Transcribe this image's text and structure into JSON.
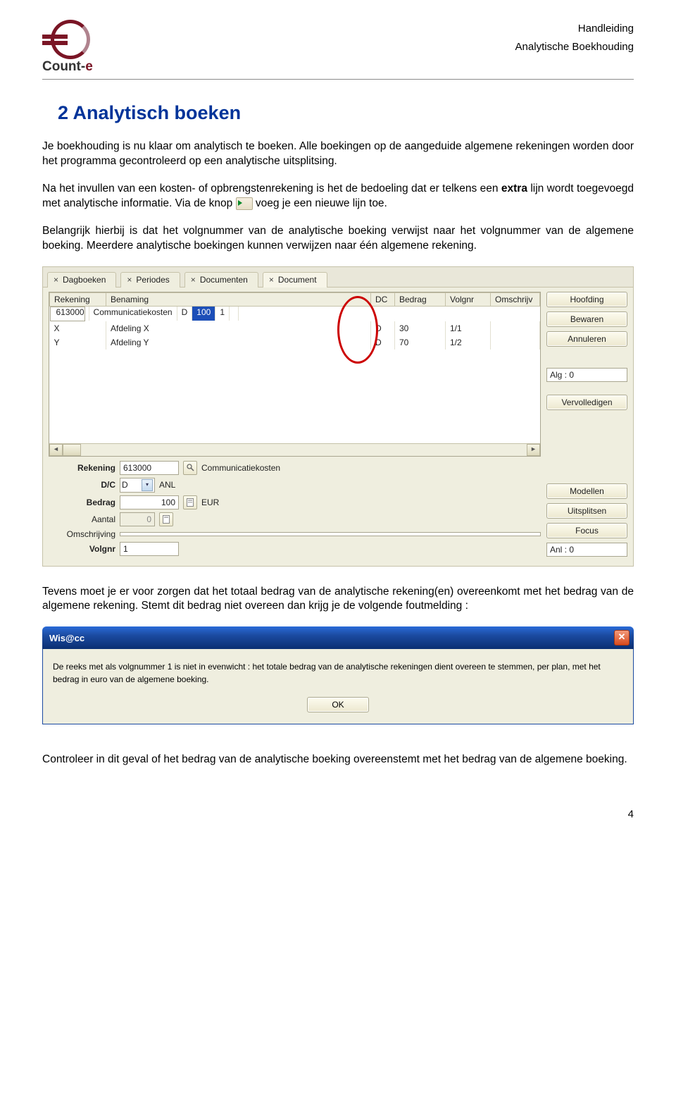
{
  "header": {
    "logo_text_1": "Count-",
    "logo_text_2": "e",
    "right_line1": "Handleiding",
    "right_line2": "Analytische Boekhouding"
  },
  "title": "2 Analytisch boeken",
  "para1": "Je boekhouding is nu klaar om analytisch te boeken. Alle boekingen op de aangeduide algemene rekeningen worden door het programma gecontroleerd op een analytische uitsplitsing.",
  "para2_a": "Na het invullen van een kosten- of opbrengstenrekening is het de bedoeling dat er telkens een ",
  "para2_bold": "extra",
  "para2_b": " lijn wordt toegevoegd met analytische informatie. Via de knop ",
  "para2_c": " voeg je een nieuwe lijn toe.",
  "para3": "Belangrijk hierbij is dat het volgnummer van de analytische boeking verwijst naar het volgnummer van de algemene boeking. Meerdere analytische boekingen kunnen verwijzen naar één algemene rekening.",
  "app": {
    "tabs": [
      "Dagboeken",
      "Periodes",
      "Documenten",
      "Document"
    ],
    "columns": [
      "Rekening",
      "Benaming",
      "DC",
      "Bedrag",
      "Volgnr",
      "Omschrijv"
    ],
    "rows": [
      {
        "rek": "613000",
        "ben": "Communicatiekosten",
        "dc": "D",
        "bedrag": "100",
        "volg": "1",
        "oms": ""
      },
      {
        "rek": "X",
        "ben": "Afdeling X",
        "dc": "D",
        "bedrag": "30",
        "volg": "1/1",
        "oms": ""
      },
      {
        "rek": "Y",
        "ben": "Afdeling Y",
        "dc": "D",
        "bedrag": "70",
        "volg": "1/2",
        "oms": ""
      }
    ],
    "side_buttons_top": [
      "Hoofding",
      "Bewaren",
      "Annuleren"
    ],
    "alg_label": "Alg : 0",
    "vervolledigen": "Vervolledigen",
    "side_buttons_bottom": [
      "Modellen",
      "Uitsplitsen",
      "Focus"
    ],
    "anl_label": "Anl : 0",
    "form": {
      "rekening_label": "Rekening",
      "rekening_value": "613000",
      "rekening_desc": "Communicatiekosten",
      "dc_label": "D/C",
      "dc_value": "D",
      "anl": "ANL",
      "bedrag_label": "Bedrag",
      "bedrag_value": "100",
      "bedrag_unit": "EUR",
      "aantal_label": "Aantal",
      "aantal_value": "0",
      "oms_label": "Omschrijving",
      "oms_value": "",
      "volg_label": "Volgnr",
      "volg_value": "1"
    }
  },
  "para4": "Tevens moet je er voor zorgen dat het totaal bedrag van de analytische rekening(en) overeenkomt met het bedrag van de algemene rekening. Stemt dit bedrag niet overeen dan krijg je de volgende foutmelding :",
  "dialog": {
    "title": "Wis@cc",
    "message": "De reeks met als volgnummer 1 is niet in evenwicht : het totale bedrag van de analytische rekeningen dient overeen te stemmen, per plan, met het bedrag in euro van de algemene boeking.",
    "ok": "OK"
  },
  "para5": "Controleer in dit geval of het bedrag van de analytische boeking overeenstemt met het bedrag van de algemene boeking.",
  "page_number": "4"
}
